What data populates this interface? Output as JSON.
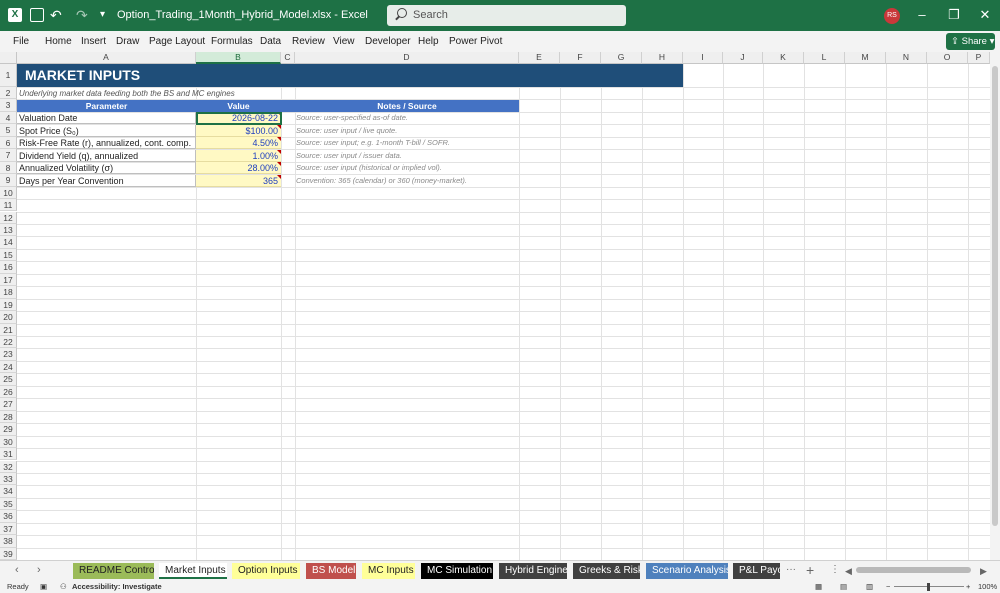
{
  "window": {
    "title": "Option_Trading_1Month_Hybrid_Model.xlsx  -  Excel",
    "search_placeholder": "Search",
    "user_initials": "RS"
  },
  "menu": [
    "File",
    "Home",
    "Insert",
    "Draw",
    "Page Layout",
    "Formulas",
    "Data",
    "Review",
    "View",
    "Developer",
    "Help",
    "Power Pivot"
  ],
  "share_label": "Share",
  "columns": [
    "A",
    "B",
    "C",
    "D",
    "E",
    "F",
    "G",
    "H",
    "I",
    "J",
    "K",
    "L",
    "M",
    "N",
    "O",
    "P"
  ],
  "selected_column": "B",
  "rows": [
    "1",
    "2",
    "3",
    "4",
    "5",
    "6",
    "7",
    "8",
    "9",
    "10",
    "11",
    "12",
    "13",
    "14",
    "15",
    "16",
    "17",
    "18",
    "19",
    "20",
    "21",
    "22",
    "23",
    "24",
    "25",
    "26",
    "27",
    "28",
    "29",
    "30",
    "31",
    "32",
    "33",
    "34",
    "35",
    "36",
    "37",
    "38",
    "39"
  ],
  "sheet": {
    "banner": "MARKET INPUTS",
    "subtitle": "Underlying market data feeding both the BS and MC engines",
    "headers": {
      "parameter": "Parameter",
      "value": "Value",
      "notes": "Notes / Source"
    },
    "inputs": [
      {
        "parameter": "Valuation Date",
        "value": "2026-08-22",
        "note": "Source: user-specified as-of date."
      },
      {
        "parameter": "Spot Price (S₀)",
        "value": "$100.00",
        "note": "Source: user input / live quote."
      },
      {
        "parameter": "Risk-Free Rate (r), annualized, cont. comp.",
        "value": "4.50%",
        "note": "Source: user input; e.g. 1-month T-bill / SOFR."
      },
      {
        "parameter": "Dividend Yield (q), annualized",
        "value": "1.00%",
        "note": "Source: user input / issuer data."
      },
      {
        "parameter": "Annualized Volatility (σ)",
        "value": "28.00%",
        "note": "Source: user input (historical or implied vol)."
      },
      {
        "parameter": "Days per Year Convention",
        "value": "365",
        "note": "Convention: 365 (calendar) or 360 (money-market)."
      }
    ]
  },
  "tabs": [
    {
      "label": "README Control",
      "color": "#9bbb59",
      "text": "#222222"
    },
    {
      "label": "Market Inputs",
      "color": "#ffffff",
      "text": "#222222",
      "active": true
    },
    {
      "label": "Option Inputs",
      "color": "#ffff99",
      "text": "#222222"
    },
    {
      "label": "BS Model",
      "color": "#c0504d",
      "text": "#ffffff"
    },
    {
      "label": "MC Inputs",
      "color": "#ffff99",
      "text": "#222222"
    },
    {
      "label": "MC Simulation",
      "color": "#000000",
      "text": "#ffffff"
    },
    {
      "label": "Hybrid Engine",
      "color": "#404040",
      "text": "#ffffff"
    },
    {
      "label": "Greeks & Risk",
      "color": "#404040",
      "text": "#ffffff"
    },
    {
      "label": "Scenario Analysis",
      "color": "#4f81bd",
      "text": "#ffffff"
    },
    {
      "label": "P&L Payoff",
      "color": "#404040",
      "text": "#ffffff"
    }
  ],
  "status": {
    "ready": "Ready",
    "accessibility": "Accessibility: Investigate",
    "zoom": "100%"
  },
  "colors": {
    "excel_green": "#1e7145",
    "banner": "#1f4e79",
    "header": "#4472c4",
    "input_fill": "#fff9c4",
    "input_text": "#1f3fbf"
  }
}
